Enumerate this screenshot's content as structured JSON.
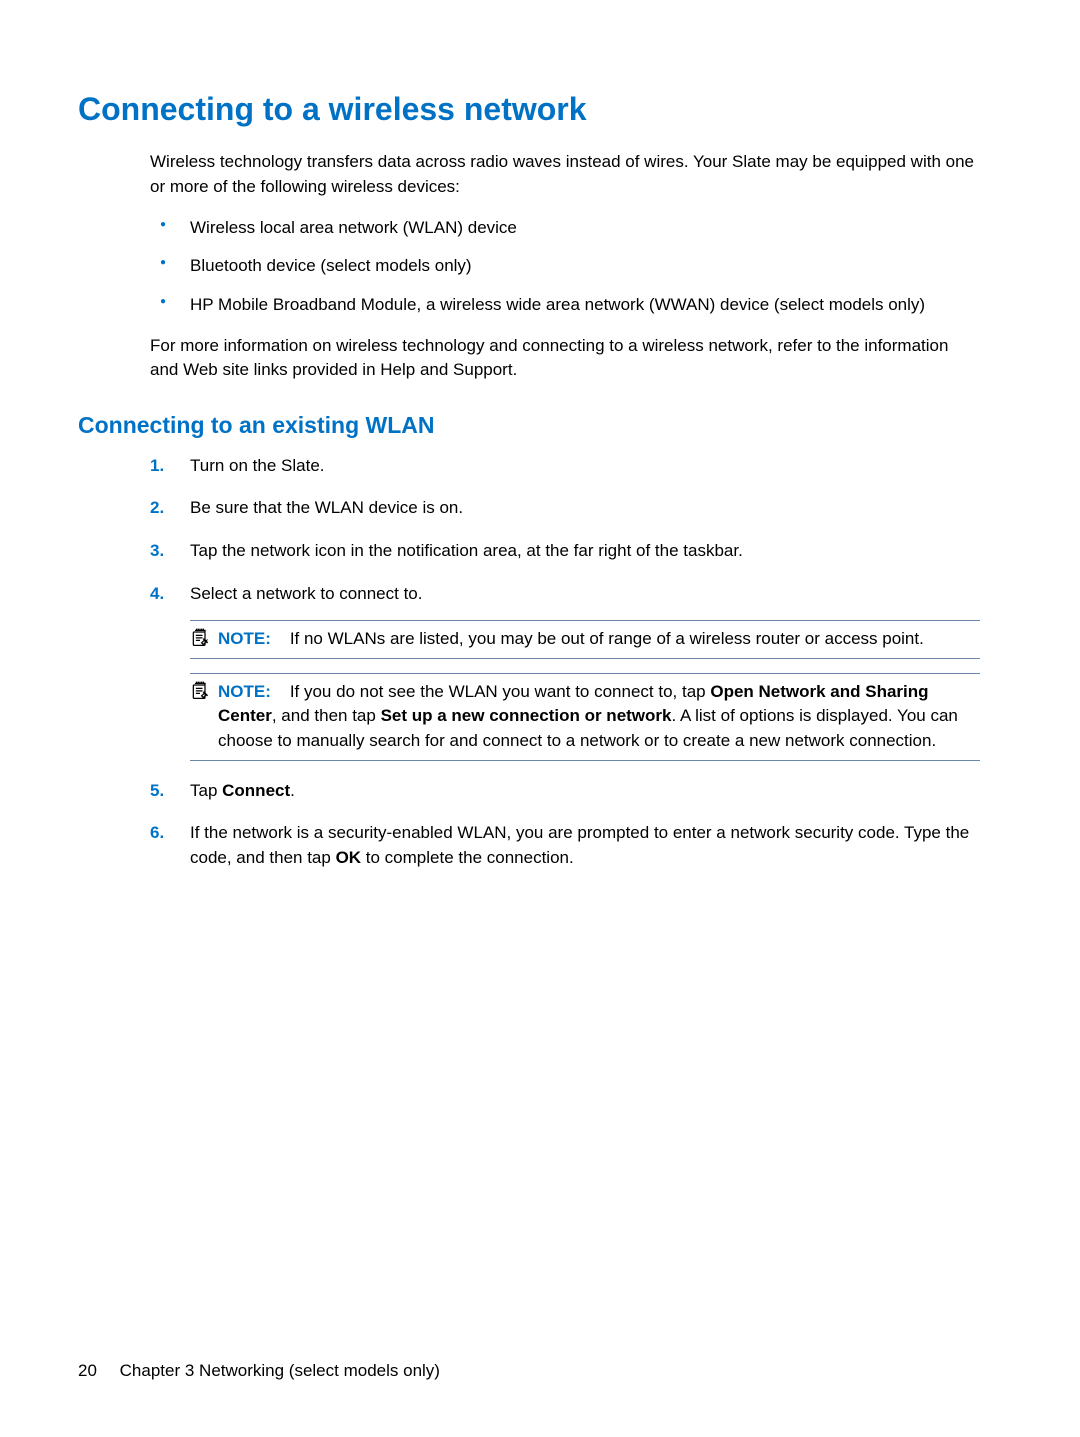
{
  "heading1": "Connecting to a wireless network",
  "intro": "Wireless technology transfers data across radio waves instead of wires. Your Slate may be equipped with one or more of the following wireless devices:",
  "bullets": [
    "Wireless local area network (WLAN) device",
    "Bluetooth device (select models only)",
    "HP Mobile Broadband Module, a wireless wide area network (WWAN) device (select models only)"
  ],
  "post_bullets": "For more information on wireless technology and connecting to a wireless network, refer to the information and Web site links provided in Help and Support.",
  "heading2": "Connecting to an existing WLAN",
  "steps": {
    "s1": "Turn on the Slate.",
    "s2": "Be sure that the WLAN device is on.",
    "s3": "Tap the network icon in the notification area, at the far right of the taskbar.",
    "s4": "Select a network to connect to.",
    "s5_pre": "Tap ",
    "s5_bold": "Connect",
    "s5_post": ".",
    "s6_pre": "If the network is a security-enabled WLAN, you are prompted to enter a network security code. Type the code, and then tap ",
    "s6_bold": "OK",
    "s6_post": " to complete the connection."
  },
  "note_label": "NOTE:",
  "note1": "If no WLANs are listed, you may be out of range of a wireless router or access point.",
  "note2_a": "If you do not see the WLAN you want to connect to, tap ",
  "note2_b1": "Open Network and Sharing Center",
  "note2_c": ", and then tap ",
  "note2_b2": "Set up a new connection or network",
  "note2_d": ". A list of options is displayed. You can choose to manually search for and connect to a network or to create a new network connection.",
  "footer": {
    "page": "20",
    "chapter": "Chapter 3   Networking (select models only)"
  }
}
